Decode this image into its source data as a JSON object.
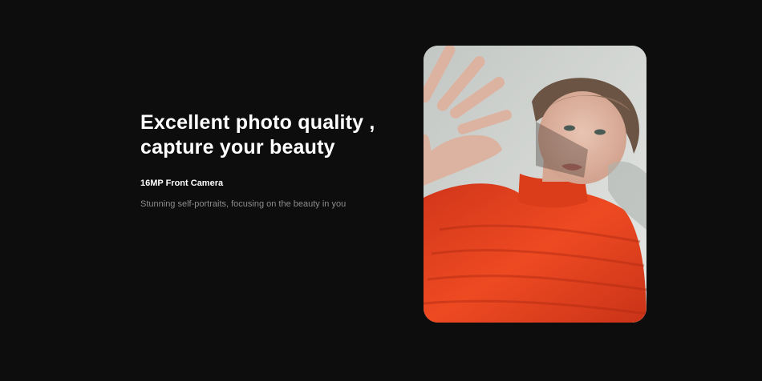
{
  "feature": {
    "headline_line1": "Excellent photo quality ,",
    "headline_line2": "capture your beauty",
    "subtitle": "16MP Front Camera",
    "description": "Stunning self-portraits, focusing on the beauty in you"
  },
  "colors": {
    "background": "#0d0d0e",
    "headline": "#ffffff",
    "description": "#8c8c8c",
    "sweater": "#e0401e"
  },
  "photo": {
    "alt": "Selfie of a person with short hair in a red sweater, hand raised, casting shadows"
  }
}
